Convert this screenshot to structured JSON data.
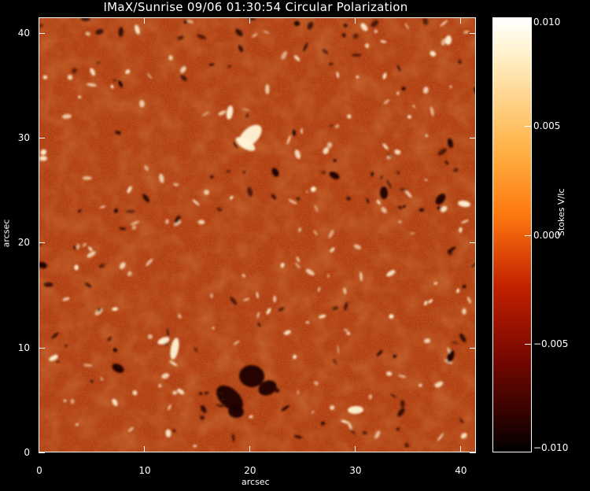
{
  "title": "IMaX/Sunrise 09/06 01:30:54 Circular Polarization",
  "x_axis": {
    "label": "arcsec",
    "ticks": [
      "0",
      "10",
      "20",
      "30",
      "40"
    ],
    "tick_values": [
      0,
      10,
      20,
      30,
      40
    ],
    "range": [
      0,
      41.5
    ]
  },
  "y_axis": {
    "label": "arcsec",
    "ticks": [
      "0",
      "10",
      "20",
      "30",
      "40"
    ],
    "tick_values": [
      0,
      10,
      20,
      30,
      40
    ],
    "range": [
      0,
      41.5
    ]
  },
  "colorbar": {
    "label": "Stokes V/Ic",
    "ticks": [
      "0.010",
      "0.005",
      "0.000",
      "−0.005",
      "−0.010"
    ],
    "tick_values": [
      0.01,
      0.005,
      0.0,
      -0.005,
      -0.01
    ],
    "range": [
      -0.01,
      0.01
    ]
  },
  "colors": {
    "background": "#000000",
    "field_base": "#b83a0e",
    "positive_patch": "#fff4d6",
    "negative_patch": "#1a0200"
  }
}
